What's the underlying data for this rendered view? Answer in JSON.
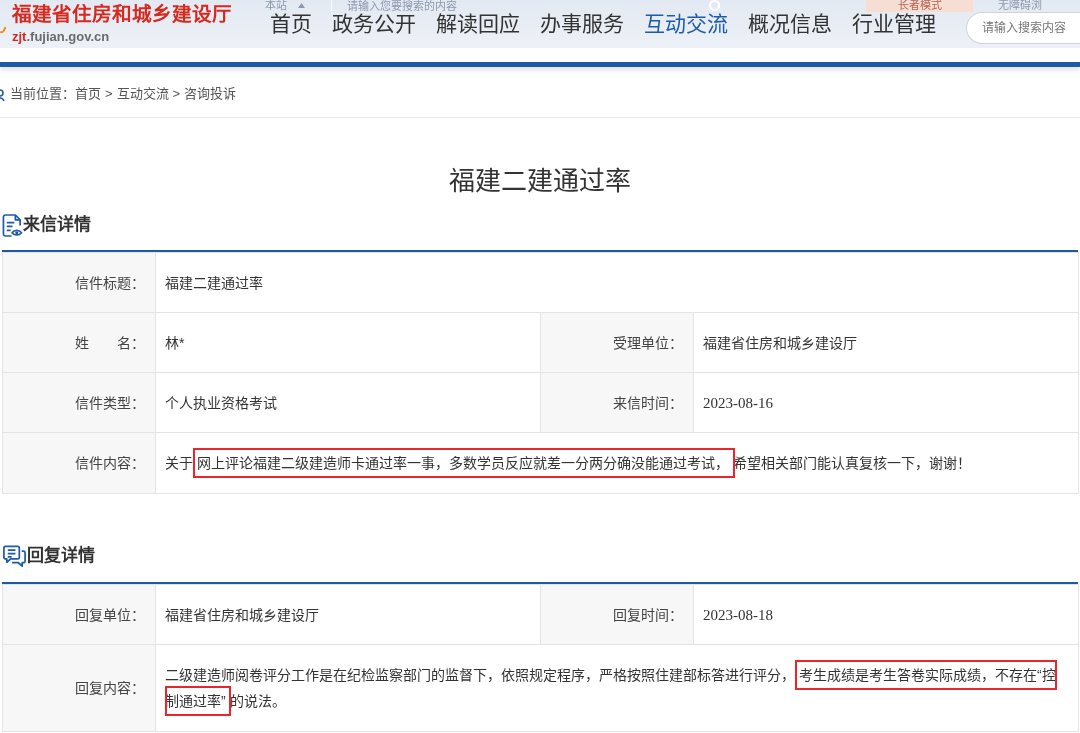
{
  "header": {
    "site_name": "福建省住房和城乡建设厅",
    "domain": {
      "prefix": "zjt",
      "rest": ".fujian.gov.cn"
    },
    "top_bar": {
      "scope": "本站",
      "search_placeholder": "请输入您要搜索的内容",
      "elder_mode": "长者模式",
      "accessibility": "无障碍浏"
    },
    "nav": [
      {
        "label": "首页",
        "selected": false
      },
      {
        "label": "政务公开",
        "selected": false
      },
      {
        "label": "解读回应",
        "selected": false
      },
      {
        "label": "办事服务",
        "selected": false
      },
      {
        "label": "互动交流",
        "selected": true
      },
      {
        "label": "概况信息",
        "selected": false
      },
      {
        "label": "行业管理",
        "selected": false
      }
    ],
    "search": {
      "placeholder": "请输入搜索内容"
    }
  },
  "breadcrumb": {
    "label": "当前位置：",
    "items": [
      {
        "text": "首页"
      },
      {
        "text": "互动交流",
        "separator": ">"
      },
      {
        "text": "咨询投诉",
        "separator": ">"
      }
    ]
  },
  "title": "福建二建通过率",
  "letter": {
    "heading": "来信详情",
    "rows": [
      {
        "fields": [
          {
            "label": "信件标题：",
            "kind": "text",
            "value": "福建二建通过率"
          }
        ]
      },
      {
        "fields": [
          {
            "label": "姓　　名：",
            "kind": "text",
            "value": "林*"
          },
          {
            "label": "受理单位：",
            "kind": "text",
            "value": "福建省住房和城乡建设厅"
          }
        ]
      },
      {
        "fields": [
          {
            "label": "信件类型：",
            "kind": "text",
            "value": "个人执业资格考试"
          },
          {
            "label": "来信时间：",
            "kind": "date",
            "value": "2023-08-16"
          }
        ]
      },
      {
        "fields": [
          {
            "label": "信件内容：",
            "kind": "marked",
            "segments": [
              {
                "text": "关于",
                "highlighted": false
              },
              {
                "text": "网上评论福建二级建造师卡通过率一事，多数学员反应就差一分两分确没能通过考试，",
                "highlighted": true
              },
              {
                "text": "希望相关部门能认真复核一下，谢谢！",
                "highlighted": false
              }
            ]
          }
        ]
      }
    ]
  },
  "reply": {
    "heading": "回复详情",
    "rows": [
      {
        "fields": [
          {
            "label": "回复单位：",
            "kind": "text",
            "value": "福建省住房和城乡建设厅"
          },
          {
            "label": "回复时间：",
            "kind": "date",
            "value": "2023-08-18"
          }
        ]
      },
      {
        "fields": [
          {
            "label": "回复内容：",
            "kind": "marked",
            "segments": [
              {
                "text": "二级建造师阅卷评分工作是在纪检监察部门的监督下，依照规定程序，严格按照住建部标答进行评分，",
                "highlighted": false
              },
              {
                "text": "考生成绩是考生答卷实际成绩，不存在“控制通过率”",
                "highlighted": true
              },
              {
                "text": "的说法。",
                "highlighted": false
              }
            ]
          }
        ]
      }
    ]
  }
}
